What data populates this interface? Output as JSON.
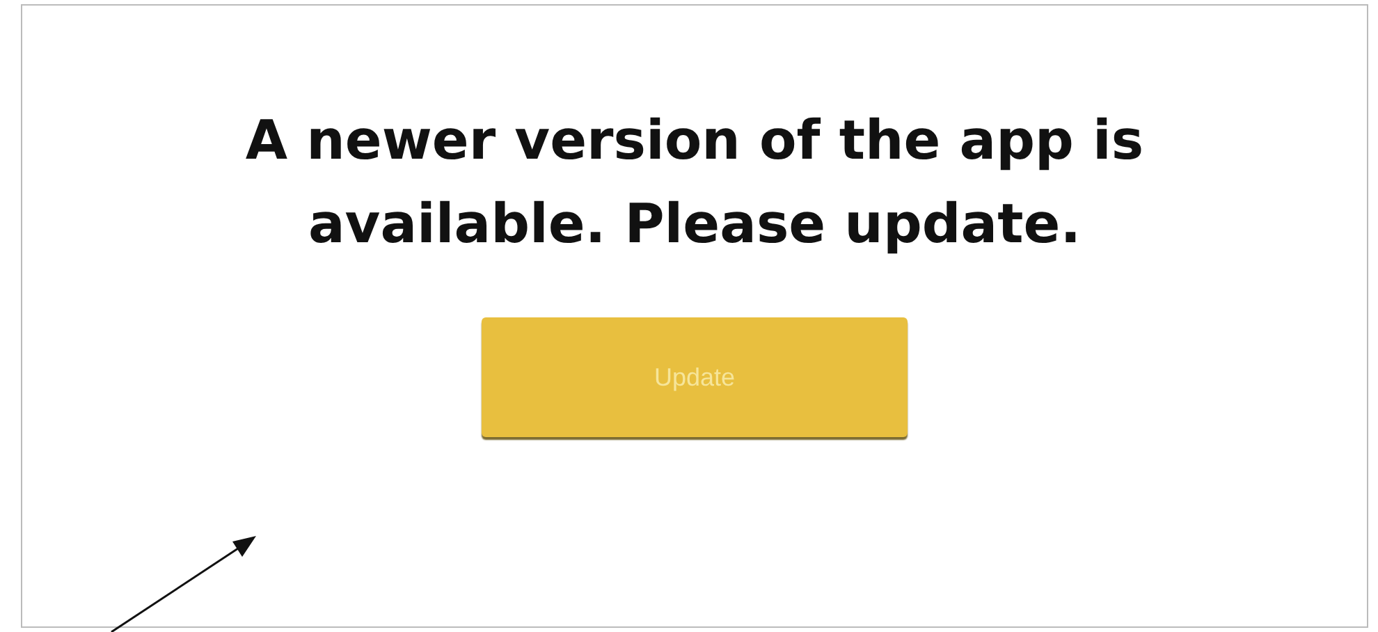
{
  "message": "A newer version of the app is available. Please update.",
  "button": {
    "label": "Update"
  }
}
